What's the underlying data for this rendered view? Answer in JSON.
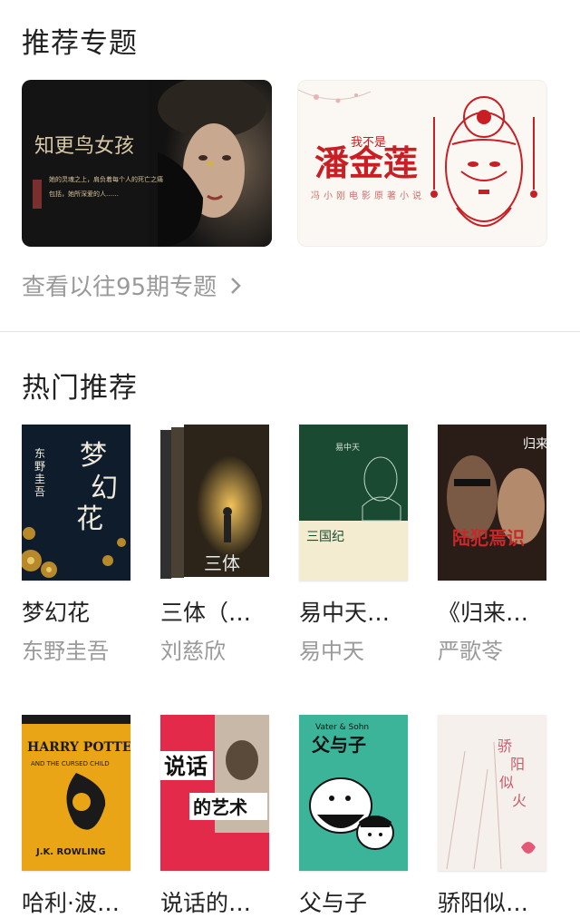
{
  "featured": {
    "title": "推荐专题",
    "banners": [
      {
        "heading": "知更鸟女孩",
        "line1": "她的灵魂之上，肩负着每个人的死亡之痛",
        "line2": "包括，她所深爱的人……"
      },
      {
        "heading": "潘金莲",
        "tag": "我不是",
        "line1": "冯小刚电影原著小说"
      }
    ],
    "more_label": "查看以往95期专题"
  },
  "hot": {
    "title": "热门推荐",
    "books": [
      {
        "title": "梦幻花",
        "author": "东野圭吾",
        "cover_text": "梦幻花",
        "cover_author": "东野圭吾"
      },
      {
        "title": "三体（…",
        "author": "刘慈欣",
        "cover_text": "三体"
      },
      {
        "title": "易中天…",
        "author": "易中天",
        "cover_text": "三国纪",
        "cover_author": "易中天"
      },
      {
        "title": "《归来…",
        "author": "严歌苓",
        "cover_text": "陆犯焉识"
      },
      {
        "title": "哈利·波…",
        "author": "",
        "cover_text": "HARRY POTTER",
        "cover_sub": "AND THE CURSED CHILD",
        "cover_author": "J.K. ROWLING"
      },
      {
        "title": "说话的…",
        "author": "",
        "cover_text1": "说话",
        "cover_text2": "的艺术"
      },
      {
        "title": "父与子",
        "author": "",
        "cover_text": "父与子",
        "cover_sub": "Vater & Sohn"
      },
      {
        "title": "骄阳似…",
        "author": "",
        "cover_text": "骄阳似火"
      }
    ]
  }
}
